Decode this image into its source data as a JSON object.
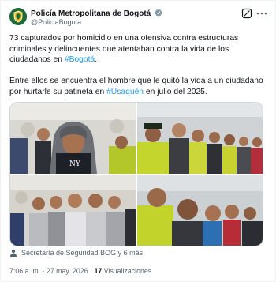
{
  "author": {
    "name": "Policía Metropolitana de Bogotá",
    "handle": "@PoliciaBogota"
  },
  "icons": {
    "avatar": "police-shield-icon",
    "verified": "verified-badge-icon",
    "grok": "grok-icon",
    "more": "more-options-icon",
    "person": "person-icon"
  },
  "colors": {
    "hashtag": "#1d9bf0",
    "verified": "#829aab",
    "avatar_bg": "#1f6b36"
  },
  "tweet": {
    "p1_text": "73 capturados por homicidio en una ofensiva contra estructuras criminales y delincuentes que atentaban contra la vida de los ciudadanos en ",
    "p1_hashtag": "#Bogotá",
    "p1_end": ".",
    "p2_text": "Entre ellos se encuentra el hombre que le quitó la vida a un ciudadano por hurtarle su patineta en ",
    "p2_hashtag": "#Usaquén",
    "p2_end": " en julio del 2025."
  },
  "media": {
    "count": 4
  },
  "tagged": {
    "text": "Secretaría de Seguridad BOG y 6 más"
  },
  "meta": {
    "time": "7:06 a. m.",
    "separator": " · ",
    "date": "27 may. 2026",
    "views_count": "17",
    "views_label": " Visualizaciones"
  }
}
